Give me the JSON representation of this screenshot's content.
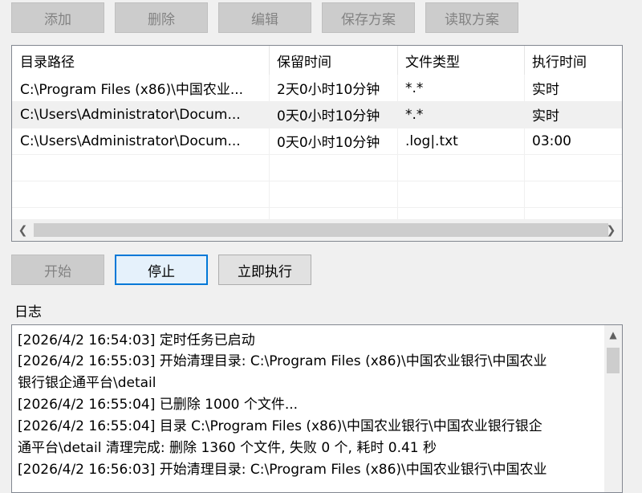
{
  "toolbar": {
    "add_label": "添加",
    "delete_label": "删除",
    "edit_label": "编辑",
    "save_scheme_label": "保存方案",
    "load_scheme_label": "读取方案"
  },
  "table": {
    "columns": [
      "目录路径",
      "保留时间",
      "文件类型",
      "执行时间"
    ],
    "rows": [
      [
        "C:\\Program Files (x86)\\中国农业...",
        "2天0小时10分钟",
        "*.*",
        "实时"
      ],
      [
        "C:\\Users\\Administrator\\Docum...",
        "0天0小时10分钟",
        "*.*",
        "实时"
      ],
      [
        "C:\\Users\\Administrator\\Docum...",
        "0天0小时10分钟",
        ".log|.txt",
        "03:00"
      ]
    ],
    "selected_row": 1
  },
  "actions": {
    "start_label": "开始",
    "stop_label": "停止",
    "run_now_label": "立即执行"
  },
  "log": {
    "label": "日志",
    "lines": [
      "[2026/4/2 16:54:03] 定时任务已启动",
      "[2026/4/2 16:55:03] 开始清理目录: C:\\Program Files (x86)\\中国农业银行\\中国农业",
      "银行银企通平台\\detail",
      "[2026/4/2 16:55:04] 已删除 1000 个文件...",
      "[2026/4/2 16:55:04] 目录 C:\\Program Files (x86)\\中国农业银行\\中国农业银行银企",
      "通平台\\detail 清理完成: 删除 1360 个文件, 失败 0 个, 耗时 0.41 秒",
      "[2026/4/2 16:56:03] 开始清理目录: C:\\Program Files (x86)\\中国农业银行\\中国农业"
    ]
  },
  "icons": {
    "scroll_left": "chevron-left-icon",
    "scroll_right": "chevron-right-icon",
    "scroll_up": "chevron-up-icon"
  },
  "colors": {
    "focus_border": "#0078d7",
    "window_bg": "#f0f0f0"
  }
}
